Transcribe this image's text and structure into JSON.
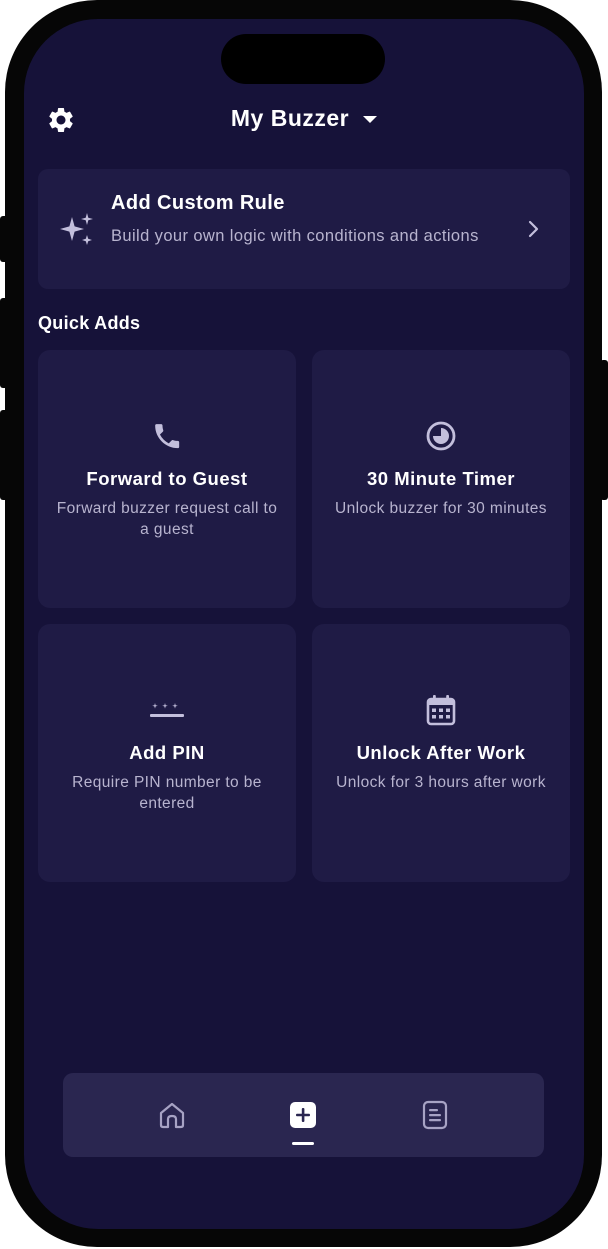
{
  "header": {
    "title": "My Buzzer",
    "settings_icon": "gear-icon",
    "dropdown_icon": "caret-down-icon"
  },
  "custom_rule": {
    "title": "Add Custom Rule",
    "subtitle": "Build your own logic with conditions and actions",
    "icon": "sparkles-icon",
    "chevron_icon": "chevron-right-icon"
  },
  "quick_adds": {
    "label": "Quick Adds",
    "items": [
      {
        "title": "Forward to Guest",
        "subtitle": "Forward buzzer request call to a guest",
        "icon": "phone-icon"
      },
      {
        "title": "30 Minute Timer",
        "subtitle": "Unlock buzzer for 30 minutes",
        "icon": "timer-icon"
      },
      {
        "title": "Add PIN",
        "subtitle": "Require PIN number to be entered",
        "icon": "pin-icon"
      },
      {
        "title": "Unlock After Work",
        "subtitle": "Unlock for 3 hours after work",
        "icon": "calendar-icon"
      }
    ]
  },
  "bottom_nav": {
    "items": [
      {
        "icon": "home-icon",
        "active": false
      },
      {
        "icon": "add-square-icon",
        "active": true
      },
      {
        "icon": "document-icon",
        "active": false
      }
    ]
  },
  "colors": {
    "background": "#161239",
    "card": "#1f1b45",
    "nav": "#2a2650",
    "text_primary": "#ffffff",
    "text_secondary": "#b8b4cf",
    "icon_muted": "#c3bfdc"
  }
}
